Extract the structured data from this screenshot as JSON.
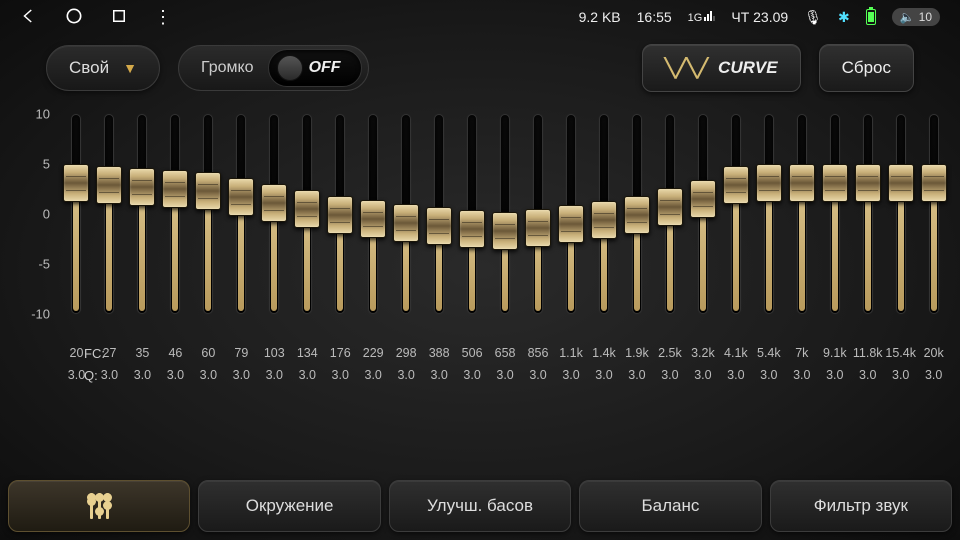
{
  "status": {
    "data": "9.2 KB",
    "time": "16:55",
    "date": "ЧТ 23.09",
    "volume": "10"
  },
  "controls": {
    "preset": "Свой",
    "loudness_label": "Громко",
    "loudness_state": "OFF",
    "curve": "CURVE",
    "reset": "Сброс"
  },
  "eq": {
    "yticks": [
      "10",
      "5",
      "0",
      "-5",
      "-10"
    ],
    "fc_label": "FC:",
    "q_label": "Q:",
    "bands": [
      {
        "fc": "20",
        "q": "3.0",
        "v": 3.2
      },
      {
        "fc": "27",
        "q": "3.0",
        "v": 3.0
      },
      {
        "fc": "35",
        "q": "3.0",
        "v": 2.8
      },
      {
        "fc": "46",
        "q": "3.0",
        "v": 2.6
      },
      {
        "fc": "60",
        "q": "3.0",
        "v": 2.4
      },
      {
        "fc": "79",
        "q": "3.0",
        "v": 1.8
      },
      {
        "fc": "103",
        "q": "3.0",
        "v": 1.2
      },
      {
        "fc": "134",
        "q": "3.0",
        "v": 0.6
      },
      {
        "fc": "176",
        "q": "3.0",
        "v": 0.0
      },
      {
        "fc": "229",
        "q": "3.0",
        "v": -0.4
      },
      {
        "fc": "298",
        "q": "3.0",
        "v": -0.8
      },
      {
        "fc": "388",
        "q": "3.0",
        "v": -1.1
      },
      {
        "fc": "506",
        "q": "3.0",
        "v": -1.4
      },
      {
        "fc": "658",
        "q": "3.0",
        "v": -1.6
      },
      {
        "fc": "856",
        "q": "3.0",
        "v": -1.3
      },
      {
        "fc": "1.1k",
        "q": "3.0",
        "v": -0.9
      },
      {
        "fc": "1.4k",
        "q": "3.0",
        "v": -0.5
      },
      {
        "fc": "1.9k",
        "q": "3.0",
        "v": 0.0
      },
      {
        "fc": "2.5k",
        "q": "3.0",
        "v": 0.8
      },
      {
        "fc": "3.2k",
        "q": "3.0",
        "v": 1.6
      },
      {
        "fc": "4.1k",
        "q": "3.0",
        "v": 3.0
      },
      {
        "fc": "5.4k",
        "q": "3.0",
        "v": 3.2
      },
      {
        "fc": "7k",
        "q": "3.0",
        "v": 3.2
      },
      {
        "fc": "9.1k",
        "q": "3.0",
        "v": 3.2
      },
      {
        "fc": "11.8k",
        "q": "3.0",
        "v": 3.2
      },
      {
        "fc": "15.4k",
        "q": "3.0",
        "v": 3.2
      },
      {
        "fc": "20k",
        "q": "3.0",
        "v": 3.2
      }
    ]
  },
  "tabs": {
    "surround": "Окружение",
    "bass": "Улучш. басов",
    "balance": "Баланс",
    "filter": "Фильтр звук"
  }
}
